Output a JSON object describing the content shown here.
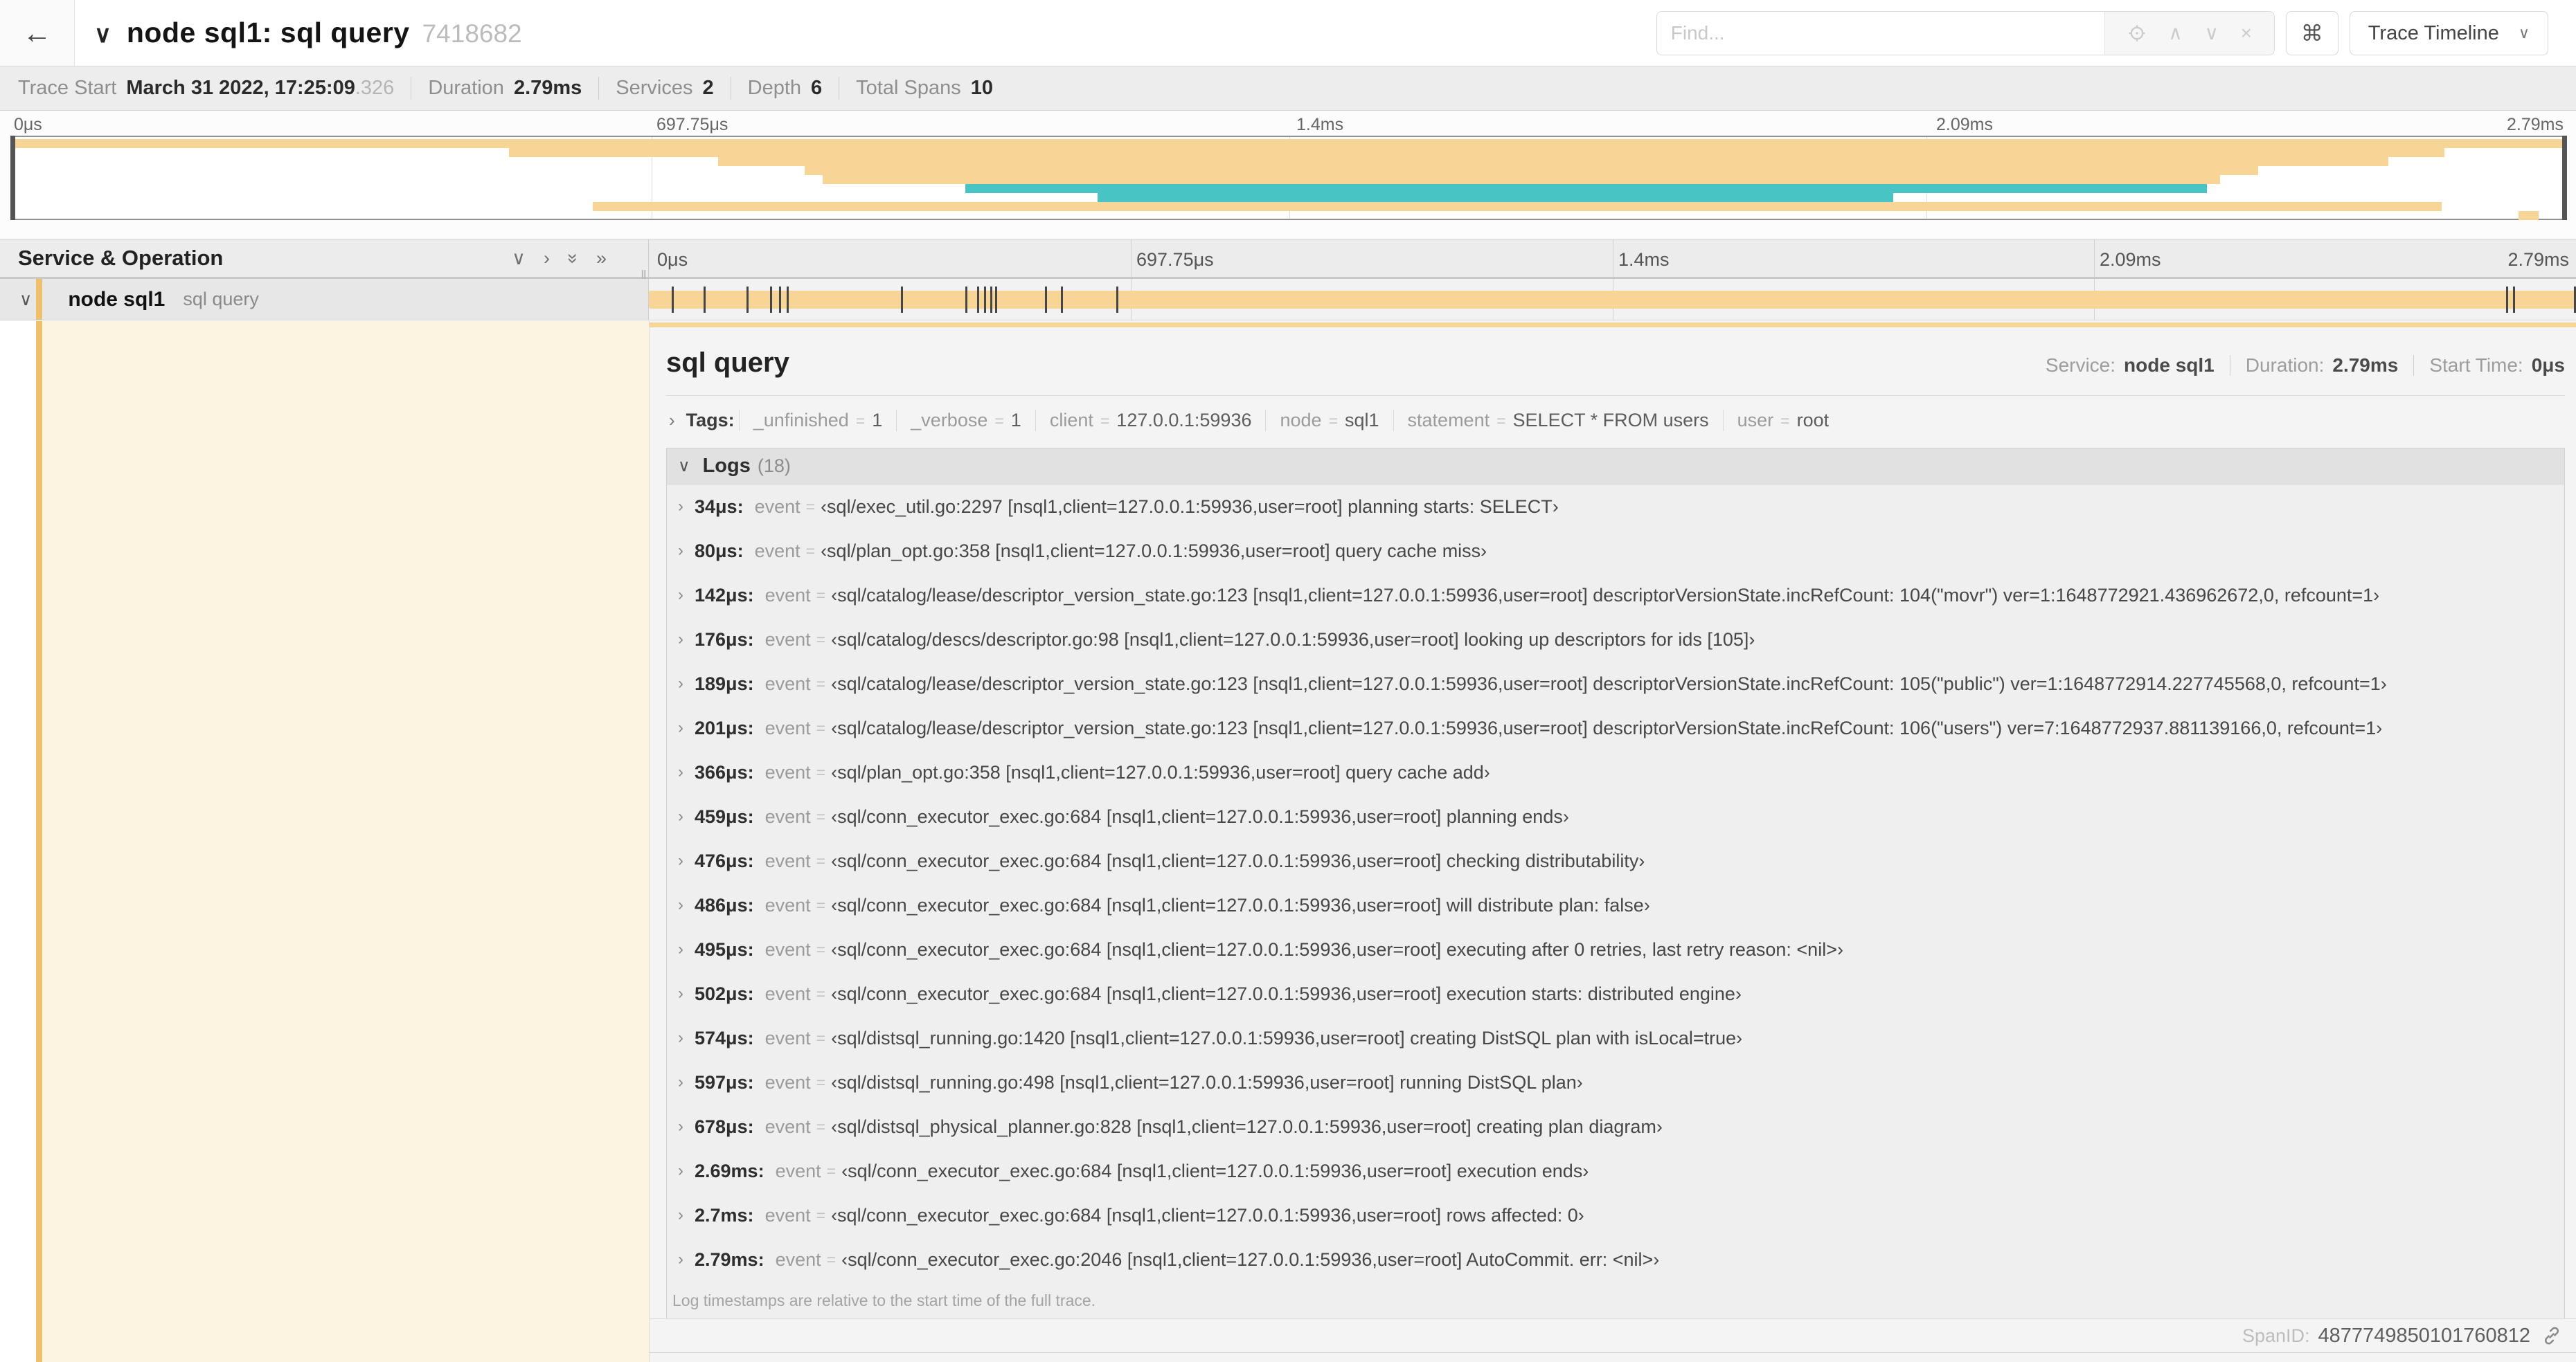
{
  "colors": {
    "amber_bar": "#f7d596",
    "amber_stripe": "#efc06c",
    "cream": "#fcf3e1",
    "teal": "#49c4c4",
    "tick": "#464646"
  },
  "header": {
    "back_icon": "←",
    "collapse_chevron": "∨",
    "title": "node sql1: sql query",
    "trace_id": "7418682",
    "find_placeholder": "Find...",
    "prev_icon": "∧",
    "next_icon": "∨",
    "clear_icon": "×",
    "shortcut_icon": "⌘",
    "view_selector": "Trace Timeline",
    "view_caret": "∨"
  },
  "trace_meta": [
    {
      "label": "Trace Start",
      "value": "March 31 2022, 17:25:09",
      "suffix": ".326"
    },
    {
      "label": "Duration",
      "value": "2.79ms",
      "suffix": ""
    },
    {
      "label": "Services",
      "value": "2",
      "suffix": ""
    },
    {
      "label": "Depth",
      "value": "6",
      "suffix": ""
    },
    {
      "label": "Total Spans",
      "value": "10",
      "suffix": ""
    }
  ],
  "minimap": {
    "axis": [
      "0μs",
      "697.75μs",
      "1.4ms",
      "2.09ms",
      "2.79ms"
    ],
    "rows": [
      {
        "start": 0.0,
        "end": 1.0,
        "color": "tan"
      },
      {
        "start": 0.194,
        "end": 0.953,
        "color": "tan"
      },
      {
        "start": 0.276,
        "end": 0.931,
        "color": "tan"
      },
      {
        "start": 0.31,
        "end": 0.88,
        "color": "tan"
      },
      {
        "start": 0.317,
        "end": 0.865,
        "color": "tan"
      },
      {
        "start": 0.373,
        "end": 0.86,
        "color": "teal"
      },
      {
        "start": 0.425,
        "end": 0.737,
        "color": "teal"
      },
      {
        "start": 0.227,
        "end": 0.952,
        "color": "tan"
      },
      {
        "start": 0.982,
        "end": 0.99,
        "color": "tan"
      }
    ]
  },
  "timeline": {
    "left_header": "Service & Operation",
    "collapse_one_icon": "∨",
    "expand_one_icon": "›",
    "collapse_all_icon": "»",
    "expand_all_icon": "»",
    "axis": [
      "0μs",
      "697.75μs",
      "1.4ms",
      "2.09ms",
      "2.79ms"
    ],
    "span": {
      "chevron": "∨",
      "service": "node sql1",
      "operation": "sql query"
    },
    "tick_times_us": [
      34,
      80,
      142,
      176,
      189,
      201,
      366,
      459,
      476,
      486,
      495,
      502,
      574,
      597,
      678,
      2690,
      2700,
      2790
    ],
    "total_us": 2790
  },
  "detail": {
    "title": "sql query",
    "service_label": "Service:",
    "service": "node sql1",
    "duration_label": "Duration:",
    "duration": "2.79ms",
    "start_label": "Start Time:",
    "start": "0μs",
    "tags_chevron": "›",
    "tags_label": "Tags:",
    "tags": [
      {
        "key": "_unfinished",
        "value": "1"
      },
      {
        "key": "_verbose",
        "value": "1"
      },
      {
        "key": "client",
        "value": "127.0.0.1:59936"
      },
      {
        "key": "node",
        "value": "sql1"
      },
      {
        "key": "statement",
        "value": "SELECT * FROM users"
      },
      {
        "key": "user",
        "value": "root"
      }
    ],
    "logs_chevron": "∨",
    "logs_label": "Logs",
    "logs_count": "(18)",
    "log_field_key": "event",
    "logs": [
      {
        "time": "34μs:",
        "value": "‹sql/exec_util.go:2297 [nsql1,client=127.0.0.1:59936,user=root] planning starts: SELECT›"
      },
      {
        "time": "80μs:",
        "value": "‹sql/plan_opt.go:358 [nsql1,client=127.0.0.1:59936,user=root] query cache miss›"
      },
      {
        "time": "142μs:",
        "value": "‹sql/catalog/lease/descriptor_version_state.go:123 [nsql1,client=127.0.0.1:59936,user=root] descriptorVersionState.incRefCount: 104(\"movr\") ver=1:1648772921.436962672,0, refcount=1›"
      },
      {
        "time": "176μs:",
        "value": "‹sql/catalog/descs/descriptor.go:98 [nsql1,client=127.0.0.1:59936,user=root] looking up descriptors for ids [105]›"
      },
      {
        "time": "189μs:",
        "value": "‹sql/catalog/lease/descriptor_version_state.go:123 [nsql1,client=127.0.0.1:59936,user=root] descriptorVersionState.incRefCount: 105(\"public\") ver=1:1648772914.227745568,0, refcount=1›"
      },
      {
        "time": "201μs:",
        "value": "‹sql/catalog/lease/descriptor_version_state.go:123 [nsql1,client=127.0.0.1:59936,user=root] descriptorVersionState.incRefCount: 106(\"users\") ver=7:1648772937.881139166,0, refcount=1›"
      },
      {
        "time": "366μs:",
        "value": "‹sql/plan_opt.go:358 [nsql1,client=127.0.0.1:59936,user=root] query cache add›"
      },
      {
        "time": "459μs:",
        "value": "‹sql/conn_executor_exec.go:684 [nsql1,client=127.0.0.1:59936,user=root] planning ends›"
      },
      {
        "time": "476μs:",
        "value": "‹sql/conn_executor_exec.go:684 [nsql1,client=127.0.0.1:59936,user=root] checking distributability›"
      },
      {
        "time": "486μs:",
        "value": "‹sql/conn_executor_exec.go:684 [nsql1,client=127.0.0.1:59936,user=root] will distribute plan: false›"
      },
      {
        "time": "495μs:",
        "value": "‹sql/conn_executor_exec.go:684 [nsql1,client=127.0.0.1:59936,user=root] executing after 0 retries, last retry reason: <nil>›"
      },
      {
        "time": "502μs:",
        "value": "‹sql/conn_executor_exec.go:684 [nsql1,client=127.0.0.1:59936,user=root] execution starts: distributed engine›"
      },
      {
        "time": "574μs:",
        "value": "‹sql/distsql_running.go:1420 [nsql1,client=127.0.0.1:59936,user=root] creating DistSQL plan with isLocal=true›"
      },
      {
        "time": "597μs:",
        "value": "‹sql/distsql_running.go:498 [nsql1,client=127.0.0.1:59936,user=root] running DistSQL plan›"
      },
      {
        "time": "678μs:",
        "value": "‹sql/distsql_physical_planner.go:828 [nsql1,client=127.0.0.1:59936,user=root] creating plan diagram›"
      },
      {
        "time": "2.69ms:",
        "value": "‹sql/conn_executor_exec.go:684 [nsql1,client=127.0.0.1:59936,user=root] execution ends›"
      },
      {
        "time": "2.7ms:",
        "value": "‹sql/conn_executor_exec.go:684 [nsql1,client=127.0.0.1:59936,user=root] rows affected: 0›"
      },
      {
        "time": "2.79ms:",
        "value": "‹sql/conn_executor_exec.go:2046 [nsql1,client=127.0.0.1:59936,user=root] AutoCommit. err: <nil>›"
      }
    ],
    "logs_note": "Log timestamps are relative to the start time of the full trace.",
    "spanid_label": "SpanID:",
    "spanid": "4877749850101760812"
  }
}
